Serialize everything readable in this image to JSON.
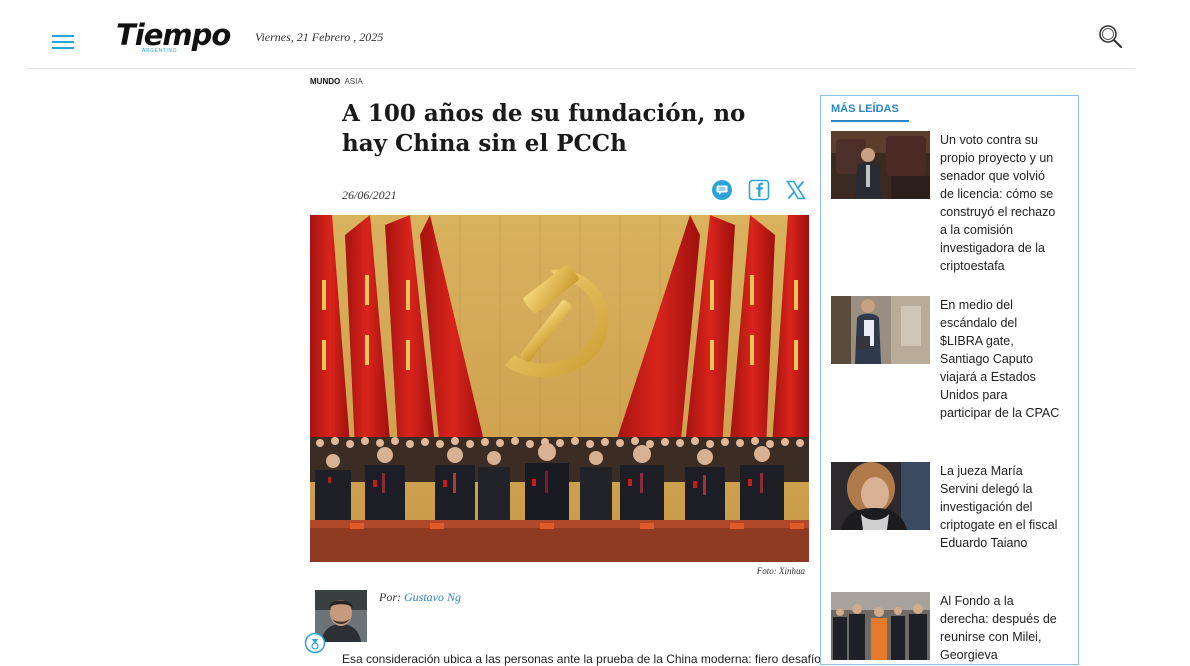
{
  "header": {
    "logo_text": "Tiempo",
    "logo_subtext": "ARGENTINO",
    "date": "Viernes, 21 Febrero , 2025"
  },
  "article": {
    "section": "MUNDO",
    "subsection": "ASIA",
    "title": "A 100 años de su fundación, no hay China sin el PCCh",
    "date": "26/06/2021",
    "photo_credit": "Foto: Xinhua",
    "byline_prefix": "Por:",
    "author": "Gustavo Ng",
    "body_start": "Esa consideración ubica a las personas ante la prueba de la China moderna: fiero desafío..."
  },
  "share": {
    "icons": [
      "comments-icon",
      "facebook-icon",
      "x-twitter-icon"
    ]
  },
  "sidebar": {
    "title": "MÁS LEÍDAS",
    "items": [
      {
        "text": "Un voto contra su propio proyecto y un senador que volvió de licencia: cómo se construyó el rechazo a la comisión investigadora de la criptoestafa"
      },
      {
        "text": "En medio del escándalo del $LIBRA gate, Santiago Caputo viajará a Estados Unidos para participar de la CPAC"
      },
      {
        "text": "La jueza María Servini delegó la investigación del criptogate en el fiscal Eduardo Taiano"
      },
      {
        "text": "Al Fondo a la derecha: después de reunirse con Milei, Georgieva"
      }
    ]
  },
  "colors": {
    "accent": "#2aa3d8",
    "link": "#2a86c4",
    "sidebar_border": "#8cc2e6"
  }
}
